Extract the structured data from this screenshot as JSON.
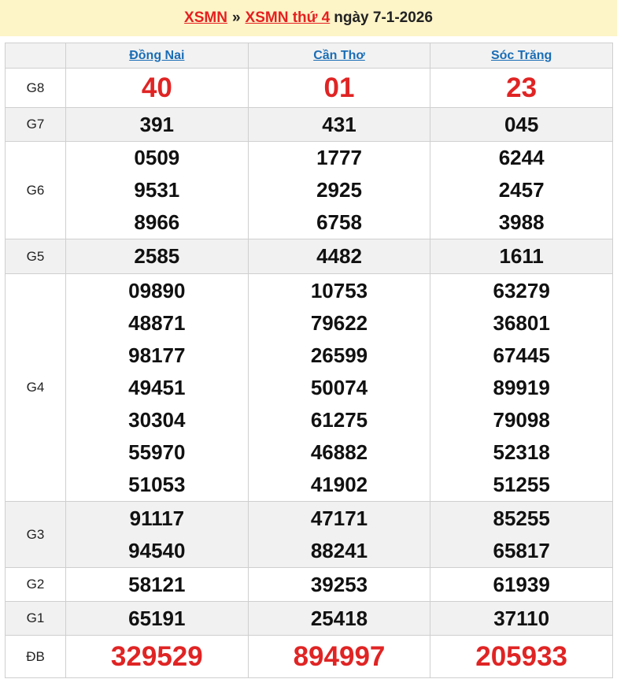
{
  "header": {
    "link1": "XSMN",
    "separator": "»",
    "link2": "XSMN thứ 4",
    "date_text": "ngày 7-1-2026"
  },
  "columns": [
    "Đồng Nai",
    "Cần Thơ",
    "Sóc Trăng"
  ],
  "colors": {
    "accent_red": "#e02424",
    "link_blue": "#1a6db5",
    "title_bg": "#fdf4c8"
  },
  "prizes": [
    {
      "label": "G8",
      "values": [
        [
          "40"
        ],
        [
          "01"
        ],
        [
          "23"
        ]
      ]
    },
    {
      "label": "G7",
      "values": [
        [
          "391"
        ],
        [
          "431"
        ],
        [
          "045"
        ]
      ]
    },
    {
      "label": "G6",
      "values": [
        [
          "0509",
          "9531",
          "8966"
        ],
        [
          "1777",
          "2925",
          "6758"
        ],
        [
          "6244",
          "2457",
          "3988"
        ]
      ]
    },
    {
      "label": "G5",
      "values": [
        [
          "2585"
        ],
        [
          "4482"
        ],
        [
          "1611"
        ]
      ]
    },
    {
      "label": "G4",
      "values": [
        [
          "09890",
          "48871",
          "98177",
          "49451",
          "30304",
          "55970",
          "51053"
        ],
        [
          "10753",
          "79622",
          "26599",
          "50074",
          "61275",
          "46882",
          "41902"
        ],
        [
          "63279",
          "36801",
          "67445",
          "89919",
          "79098",
          "52318",
          "51255"
        ]
      ]
    },
    {
      "label": "G3",
      "values": [
        [
          "91117",
          "94540"
        ],
        [
          "47171",
          "88241"
        ],
        [
          "85255",
          "65817"
        ]
      ]
    },
    {
      "label": "G2",
      "values": [
        [
          "58121"
        ],
        [
          "39253"
        ],
        [
          "61939"
        ]
      ]
    },
    {
      "label": "G1",
      "values": [
        [
          "65191"
        ],
        [
          "25418"
        ],
        [
          "37110"
        ]
      ]
    },
    {
      "label": "ĐB",
      "values": [
        [
          "329529"
        ],
        [
          "894997"
        ],
        [
          "205933"
        ]
      ]
    }
  ]
}
